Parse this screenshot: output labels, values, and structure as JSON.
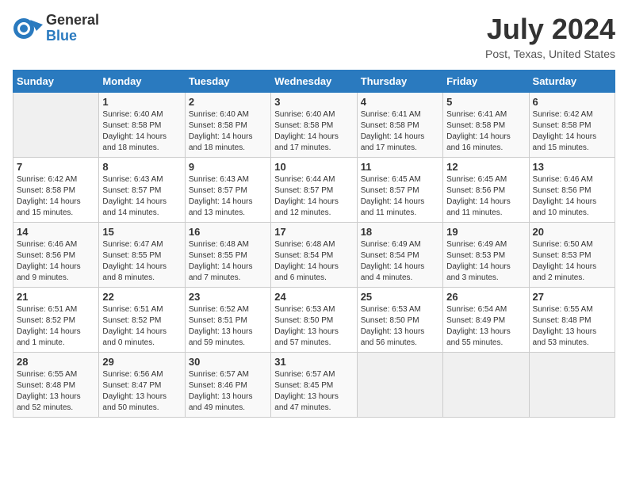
{
  "header": {
    "logo_line1": "General",
    "logo_line2": "Blue",
    "month_year": "July 2024",
    "location": "Post, Texas, United States"
  },
  "days_of_week": [
    "Sunday",
    "Monday",
    "Tuesday",
    "Wednesday",
    "Thursday",
    "Friday",
    "Saturday"
  ],
  "weeks": [
    [
      {
        "day": "",
        "info": ""
      },
      {
        "day": "1",
        "info": "Sunrise: 6:40 AM\nSunset: 8:58 PM\nDaylight: 14 hours\nand 18 minutes."
      },
      {
        "day": "2",
        "info": "Sunrise: 6:40 AM\nSunset: 8:58 PM\nDaylight: 14 hours\nand 18 minutes."
      },
      {
        "day": "3",
        "info": "Sunrise: 6:40 AM\nSunset: 8:58 PM\nDaylight: 14 hours\nand 17 minutes."
      },
      {
        "day": "4",
        "info": "Sunrise: 6:41 AM\nSunset: 8:58 PM\nDaylight: 14 hours\nand 17 minutes."
      },
      {
        "day": "5",
        "info": "Sunrise: 6:41 AM\nSunset: 8:58 PM\nDaylight: 14 hours\nand 16 minutes."
      },
      {
        "day": "6",
        "info": "Sunrise: 6:42 AM\nSunset: 8:58 PM\nDaylight: 14 hours\nand 15 minutes."
      }
    ],
    [
      {
        "day": "7",
        "info": "Sunrise: 6:42 AM\nSunset: 8:58 PM\nDaylight: 14 hours\nand 15 minutes."
      },
      {
        "day": "8",
        "info": "Sunrise: 6:43 AM\nSunset: 8:57 PM\nDaylight: 14 hours\nand 14 minutes."
      },
      {
        "day": "9",
        "info": "Sunrise: 6:43 AM\nSunset: 8:57 PM\nDaylight: 14 hours\nand 13 minutes."
      },
      {
        "day": "10",
        "info": "Sunrise: 6:44 AM\nSunset: 8:57 PM\nDaylight: 14 hours\nand 12 minutes."
      },
      {
        "day": "11",
        "info": "Sunrise: 6:45 AM\nSunset: 8:57 PM\nDaylight: 14 hours\nand 11 minutes."
      },
      {
        "day": "12",
        "info": "Sunrise: 6:45 AM\nSunset: 8:56 PM\nDaylight: 14 hours\nand 11 minutes."
      },
      {
        "day": "13",
        "info": "Sunrise: 6:46 AM\nSunset: 8:56 PM\nDaylight: 14 hours\nand 10 minutes."
      }
    ],
    [
      {
        "day": "14",
        "info": "Sunrise: 6:46 AM\nSunset: 8:56 PM\nDaylight: 14 hours\nand 9 minutes."
      },
      {
        "day": "15",
        "info": "Sunrise: 6:47 AM\nSunset: 8:55 PM\nDaylight: 14 hours\nand 8 minutes."
      },
      {
        "day": "16",
        "info": "Sunrise: 6:48 AM\nSunset: 8:55 PM\nDaylight: 14 hours\nand 7 minutes."
      },
      {
        "day": "17",
        "info": "Sunrise: 6:48 AM\nSunset: 8:54 PM\nDaylight: 14 hours\nand 6 minutes."
      },
      {
        "day": "18",
        "info": "Sunrise: 6:49 AM\nSunset: 8:54 PM\nDaylight: 14 hours\nand 4 minutes."
      },
      {
        "day": "19",
        "info": "Sunrise: 6:49 AM\nSunset: 8:53 PM\nDaylight: 14 hours\nand 3 minutes."
      },
      {
        "day": "20",
        "info": "Sunrise: 6:50 AM\nSunset: 8:53 PM\nDaylight: 14 hours\nand 2 minutes."
      }
    ],
    [
      {
        "day": "21",
        "info": "Sunrise: 6:51 AM\nSunset: 8:52 PM\nDaylight: 14 hours\nand 1 minute."
      },
      {
        "day": "22",
        "info": "Sunrise: 6:51 AM\nSunset: 8:52 PM\nDaylight: 14 hours\nand 0 minutes."
      },
      {
        "day": "23",
        "info": "Sunrise: 6:52 AM\nSunset: 8:51 PM\nDaylight: 13 hours\nand 59 minutes."
      },
      {
        "day": "24",
        "info": "Sunrise: 6:53 AM\nSunset: 8:50 PM\nDaylight: 13 hours\nand 57 minutes."
      },
      {
        "day": "25",
        "info": "Sunrise: 6:53 AM\nSunset: 8:50 PM\nDaylight: 13 hours\nand 56 minutes."
      },
      {
        "day": "26",
        "info": "Sunrise: 6:54 AM\nSunset: 8:49 PM\nDaylight: 13 hours\nand 55 minutes."
      },
      {
        "day": "27",
        "info": "Sunrise: 6:55 AM\nSunset: 8:48 PM\nDaylight: 13 hours\nand 53 minutes."
      }
    ],
    [
      {
        "day": "28",
        "info": "Sunrise: 6:55 AM\nSunset: 8:48 PM\nDaylight: 13 hours\nand 52 minutes."
      },
      {
        "day": "29",
        "info": "Sunrise: 6:56 AM\nSunset: 8:47 PM\nDaylight: 13 hours\nand 50 minutes."
      },
      {
        "day": "30",
        "info": "Sunrise: 6:57 AM\nSunset: 8:46 PM\nDaylight: 13 hours\nand 49 minutes."
      },
      {
        "day": "31",
        "info": "Sunrise: 6:57 AM\nSunset: 8:45 PM\nDaylight: 13 hours\nand 47 minutes."
      },
      {
        "day": "",
        "info": ""
      },
      {
        "day": "",
        "info": ""
      },
      {
        "day": "",
        "info": ""
      }
    ]
  ]
}
